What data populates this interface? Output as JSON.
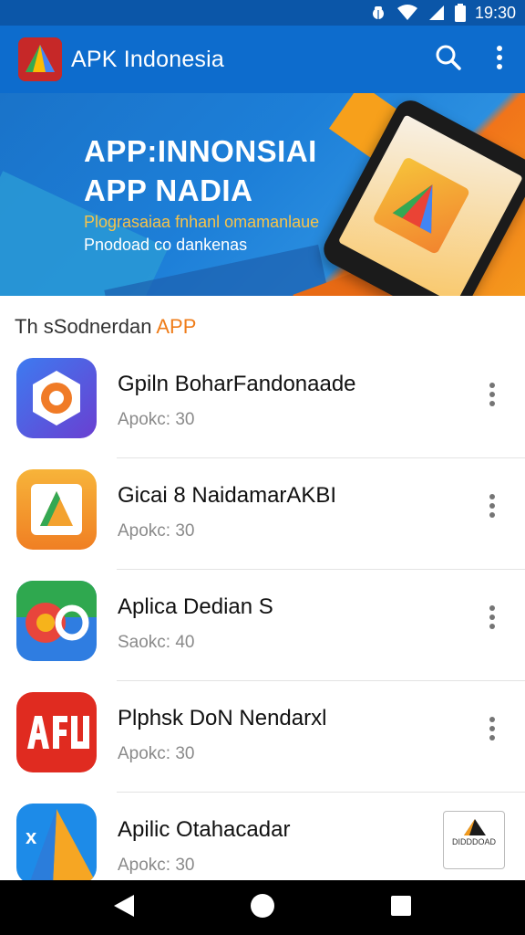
{
  "status_bar": {
    "time": "19:30",
    "icons": [
      "bug-icon",
      "wifi-icon",
      "signal-icon",
      "battery-icon"
    ]
  },
  "app_bar": {
    "title": "APK Indonesia",
    "search_icon": "search-icon",
    "menu_icon": "more-vert-icon"
  },
  "banner": {
    "line1": "APP:INNONSIAI",
    "line2": "APP NADIA",
    "sub1": "Plograsaiaa fnhanl omamanlaue",
    "sub2": "Pnodoad co dankenas"
  },
  "section": {
    "prefix": "Th sSodnerdan ",
    "accent": "APP"
  },
  "apps": [
    {
      "name": "Gpiln BoharFandonaade",
      "meta": "Apokc: 30",
      "icon": "hexagon-app-icon"
    },
    {
      "name": "Gicai 8 NaidamarAKBI",
      "meta": "Apokc: 30",
      "icon": "triangle-app-icon"
    },
    {
      "name": "Aplica Dedian S",
      "meta": "Saokc: 40",
      "icon": "circle-app-icon"
    },
    {
      "name": "Plphsk DoN Nendarxl",
      "meta": "Apokc: 30",
      "icon": "afu-app-icon"
    },
    {
      "name": "Apilic Otahacadar",
      "meta": "Apokc: 30",
      "icon": "drive-app-icon"
    }
  ],
  "mini_badge": {
    "text": "DIDDDOAD"
  },
  "colors": {
    "appbar": "#0d6ccd",
    "statusbar": "#0b56a8",
    "accent": "#ef7d1a"
  },
  "nav": {
    "back": "back-icon",
    "home": "home-icon",
    "recents": "recents-icon"
  }
}
